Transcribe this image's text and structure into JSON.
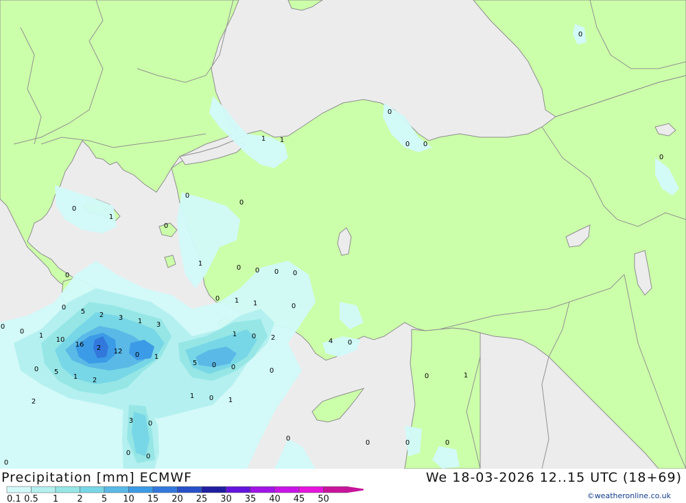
{
  "header": {
    "title": "Precipitation [mm] ECMWF",
    "datetime": "We 18-03-2026 12..15 UTC (18+69)",
    "credit": "©weatheronline.co.uk"
  },
  "legend": {
    "labels": [
      "0.1",
      "0.5",
      "1",
      "2",
      "5",
      "10",
      "15",
      "20",
      "25",
      "30",
      "35",
      "40",
      "45",
      "50"
    ],
    "colors": [
      "#d2fafa",
      "#b4f0f0",
      "#96e6e6",
      "#78d7e6",
      "#5ab9e6",
      "#3c9be6",
      "#3278dc",
      "#2850c8",
      "#1e1ea0",
      "#6414dc",
      "#a014e6",
      "#c814e6",
      "#e614dc",
      "#c8149b"
    ]
  },
  "map_colors": {
    "sea": "#ececec",
    "land": "#ccffaa",
    "border": "#909090",
    "coast": "#8c8c8c"
  },
  "precip_values": [
    {
      "v": "0"
    },
    {
      "v": "1"
    },
    {
      "v": "1"
    },
    {
      "v": "0"
    },
    {
      "v": "0"
    },
    {
      "v": "0"
    },
    {
      "v": "0"
    },
    {
      "v": "0"
    },
    {
      "v": "0"
    },
    {
      "v": "0"
    },
    {
      "v": "1"
    },
    {
      "v": "0"
    },
    {
      "v": "1"
    },
    {
      "v": "0"
    },
    {
      "v": "0"
    },
    {
      "v": "0"
    },
    {
      "v": "0"
    },
    {
      "v": "0"
    },
    {
      "v": "0"
    },
    {
      "v": "1"
    },
    {
      "v": "1"
    },
    {
      "v": "0"
    },
    {
      "v": "5"
    },
    {
      "v": "2"
    },
    {
      "v": "3"
    },
    {
      "v": "1"
    },
    {
      "v": "3"
    },
    {
      "v": "0"
    },
    {
      "v": "0"
    },
    {
      "v": "0"
    },
    {
      "v": "1"
    },
    {
      "v": "10"
    },
    {
      "v": "16"
    },
    {
      "v": "2"
    },
    {
      "v": "12"
    },
    {
      "v": "0"
    },
    {
      "v": "1"
    },
    {
      "v": "0"
    },
    {
      "v": "2"
    },
    {
      "v": "4"
    },
    {
      "v": "0"
    },
    {
      "v": "1"
    },
    {
      "v": "5"
    },
    {
      "v": "0"
    },
    {
      "v": "0"
    },
    {
      "v": "0"
    },
    {
      "v": "5"
    },
    {
      "v": "1"
    },
    {
      "v": "2"
    },
    {
      "v": "0"
    },
    {
      "v": "0"
    },
    {
      "v": "1"
    },
    {
      "v": "1"
    },
    {
      "v": "0"
    },
    {
      "v": "1"
    },
    {
      "v": "2"
    },
    {
      "v": "3"
    },
    {
      "v": "0"
    },
    {
      "v": "0"
    },
    {
      "v": "0"
    },
    {
      "v": "0"
    },
    {
      "v": "0"
    },
    {
      "v": "0"
    },
    {
      "v": "0"
    },
    {
      "v": "0"
    }
  ]
}
